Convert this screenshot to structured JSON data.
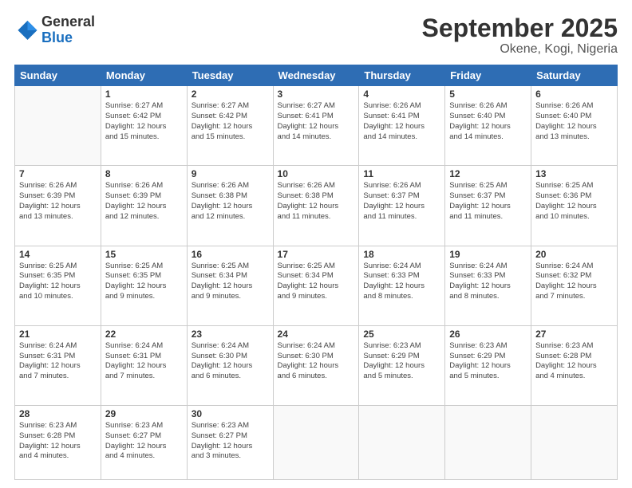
{
  "logo": {
    "general": "General",
    "blue": "Blue"
  },
  "header": {
    "title": "September 2025",
    "subtitle": "Okene, Kogi, Nigeria"
  },
  "weekdays": [
    "Sunday",
    "Monday",
    "Tuesday",
    "Wednesday",
    "Thursday",
    "Friday",
    "Saturday"
  ],
  "weeks": [
    [
      {
        "day": "",
        "info": ""
      },
      {
        "day": "1",
        "info": "Sunrise: 6:27 AM\nSunset: 6:42 PM\nDaylight: 12 hours\nand 15 minutes."
      },
      {
        "day": "2",
        "info": "Sunrise: 6:27 AM\nSunset: 6:42 PM\nDaylight: 12 hours\nand 15 minutes."
      },
      {
        "day": "3",
        "info": "Sunrise: 6:27 AM\nSunset: 6:41 PM\nDaylight: 12 hours\nand 14 minutes."
      },
      {
        "day": "4",
        "info": "Sunrise: 6:26 AM\nSunset: 6:41 PM\nDaylight: 12 hours\nand 14 minutes."
      },
      {
        "day": "5",
        "info": "Sunrise: 6:26 AM\nSunset: 6:40 PM\nDaylight: 12 hours\nand 14 minutes."
      },
      {
        "day": "6",
        "info": "Sunrise: 6:26 AM\nSunset: 6:40 PM\nDaylight: 12 hours\nand 13 minutes."
      }
    ],
    [
      {
        "day": "7",
        "info": "Sunrise: 6:26 AM\nSunset: 6:39 PM\nDaylight: 12 hours\nand 13 minutes."
      },
      {
        "day": "8",
        "info": "Sunrise: 6:26 AM\nSunset: 6:39 PM\nDaylight: 12 hours\nand 12 minutes."
      },
      {
        "day": "9",
        "info": "Sunrise: 6:26 AM\nSunset: 6:38 PM\nDaylight: 12 hours\nand 12 minutes."
      },
      {
        "day": "10",
        "info": "Sunrise: 6:26 AM\nSunset: 6:38 PM\nDaylight: 12 hours\nand 11 minutes."
      },
      {
        "day": "11",
        "info": "Sunrise: 6:26 AM\nSunset: 6:37 PM\nDaylight: 12 hours\nand 11 minutes."
      },
      {
        "day": "12",
        "info": "Sunrise: 6:25 AM\nSunset: 6:37 PM\nDaylight: 12 hours\nand 11 minutes."
      },
      {
        "day": "13",
        "info": "Sunrise: 6:25 AM\nSunset: 6:36 PM\nDaylight: 12 hours\nand 10 minutes."
      }
    ],
    [
      {
        "day": "14",
        "info": "Sunrise: 6:25 AM\nSunset: 6:35 PM\nDaylight: 12 hours\nand 10 minutes."
      },
      {
        "day": "15",
        "info": "Sunrise: 6:25 AM\nSunset: 6:35 PM\nDaylight: 12 hours\nand 9 minutes."
      },
      {
        "day": "16",
        "info": "Sunrise: 6:25 AM\nSunset: 6:34 PM\nDaylight: 12 hours\nand 9 minutes."
      },
      {
        "day": "17",
        "info": "Sunrise: 6:25 AM\nSunset: 6:34 PM\nDaylight: 12 hours\nand 9 minutes."
      },
      {
        "day": "18",
        "info": "Sunrise: 6:24 AM\nSunset: 6:33 PM\nDaylight: 12 hours\nand 8 minutes."
      },
      {
        "day": "19",
        "info": "Sunrise: 6:24 AM\nSunset: 6:33 PM\nDaylight: 12 hours\nand 8 minutes."
      },
      {
        "day": "20",
        "info": "Sunrise: 6:24 AM\nSunset: 6:32 PM\nDaylight: 12 hours\nand 7 minutes."
      }
    ],
    [
      {
        "day": "21",
        "info": "Sunrise: 6:24 AM\nSunset: 6:31 PM\nDaylight: 12 hours\nand 7 minutes."
      },
      {
        "day": "22",
        "info": "Sunrise: 6:24 AM\nSunset: 6:31 PM\nDaylight: 12 hours\nand 7 minutes."
      },
      {
        "day": "23",
        "info": "Sunrise: 6:24 AM\nSunset: 6:30 PM\nDaylight: 12 hours\nand 6 minutes."
      },
      {
        "day": "24",
        "info": "Sunrise: 6:24 AM\nSunset: 6:30 PM\nDaylight: 12 hours\nand 6 minutes."
      },
      {
        "day": "25",
        "info": "Sunrise: 6:23 AM\nSunset: 6:29 PM\nDaylight: 12 hours\nand 5 minutes."
      },
      {
        "day": "26",
        "info": "Sunrise: 6:23 AM\nSunset: 6:29 PM\nDaylight: 12 hours\nand 5 minutes."
      },
      {
        "day": "27",
        "info": "Sunrise: 6:23 AM\nSunset: 6:28 PM\nDaylight: 12 hours\nand 4 minutes."
      }
    ],
    [
      {
        "day": "28",
        "info": "Sunrise: 6:23 AM\nSunset: 6:28 PM\nDaylight: 12 hours\nand 4 minutes."
      },
      {
        "day": "29",
        "info": "Sunrise: 6:23 AM\nSunset: 6:27 PM\nDaylight: 12 hours\nand 4 minutes."
      },
      {
        "day": "30",
        "info": "Sunrise: 6:23 AM\nSunset: 6:27 PM\nDaylight: 12 hours\nand 3 minutes."
      },
      {
        "day": "",
        "info": ""
      },
      {
        "day": "",
        "info": ""
      },
      {
        "day": "",
        "info": ""
      },
      {
        "day": "",
        "info": ""
      }
    ]
  ]
}
